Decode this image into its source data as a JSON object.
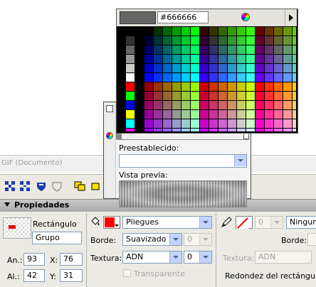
{
  "document": {
    "title": "GIF (Documento)"
  },
  "swatches": {
    "hex_value": "#666666",
    "preview_color": "#666666",
    "left_column": [
      "#000000",
      "#333333",
      "#666666",
      "#999999",
      "#cccccc",
      "#ffffff",
      "#ff0000",
      "#00ff00",
      "#0000ff",
      "#ffff00",
      "#00ffff",
      "#ff00ff"
    ]
  },
  "gradient_popup": {
    "preset_label": "Preestablecido:",
    "preset_value": "",
    "preview_label": "Vista previa:"
  },
  "properties": {
    "title": "Propiedades",
    "shape_type": "Rectángulo",
    "group_name": "Grupo",
    "width_label": "An.:",
    "width_value": "93",
    "height_label": "Al.:",
    "height_value": "42",
    "x_label": "X:",
    "x_value": "76",
    "y_label": "Y:",
    "y_value": "31",
    "fill_color": "#ff0000",
    "fill_type": "Pliegues",
    "edge_label": "Borde:",
    "edge_value": "Suavizado",
    "edge_amount": "0",
    "texture_label": "Textura:",
    "texture_value": "ADN",
    "texture_amount": "0",
    "transparent_label": "Transparente",
    "stroke_size": "0",
    "stroke_type": "Ninguno",
    "stroke_edge_label": "Borde:",
    "stroke_texture_label": "Textura:",
    "stroke_texture_value": "ADN",
    "round_label": "Redondez del rectángulo"
  }
}
